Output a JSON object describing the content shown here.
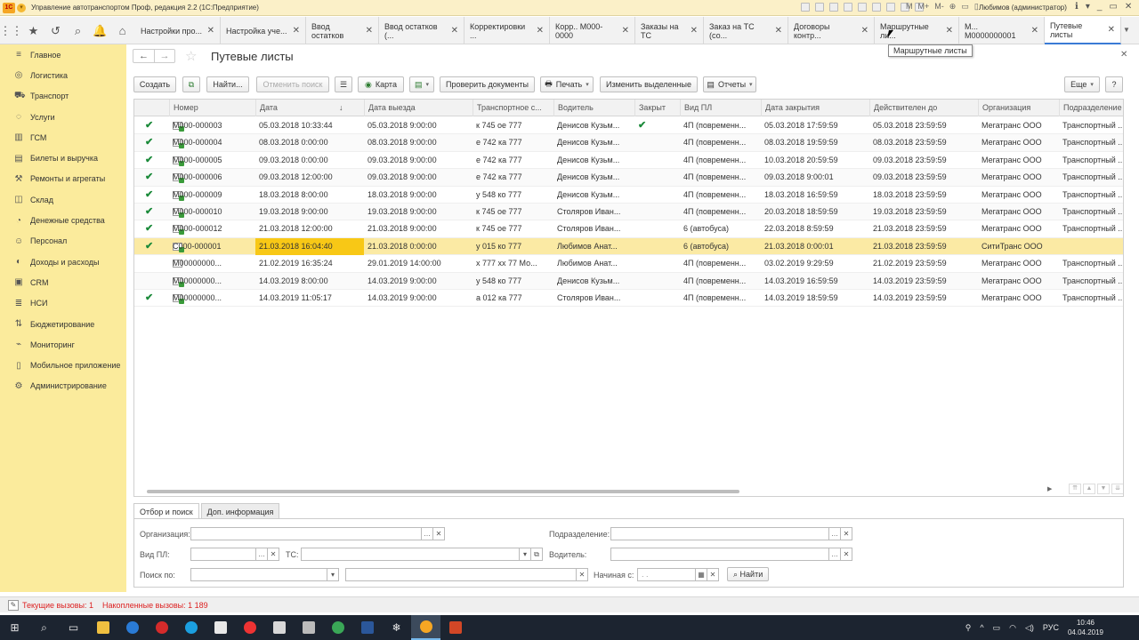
{
  "window": {
    "title": "Управление автотранспортом Проф, редакция 2.2 (1С:Предприятие)",
    "user": "Любимов (администратор)",
    "m_buttons": [
      "M",
      "M+",
      "M-"
    ]
  },
  "tabs": [
    {
      "label": "Настройки про...",
      "active": false
    },
    {
      "label": "Настройка уче...",
      "active": false
    },
    {
      "label": "Ввод остатков",
      "active": false
    },
    {
      "label": "Ввод остатков (...",
      "active": false
    },
    {
      "label": "Корректировки ...",
      "active": false
    },
    {
      "label": "Корр.. М000-0000",
      "active": false
    },
    {
      "label": "Заказы на ТС",
      "active": false
    },
    {
      "label": "Заказ на ТС (со...",
      "active": false
    },
    {
      "label": "Договоры контр...",
      "active": false
    },
    {
      "label": "Маршрутные ли...",
      "active": false
    },
    {
      "label": "М... М0000000001",
      "active": false
    },
    {
      "label": "Путевые листы",
      "active": true
    }
  ],
  "tooltip": "Маршрутные листы",
  "sidebar": {
    "items": [
      {
        "label": "Главное",
        "icon": "menu-icon"
      },
      {
        "label": "Логистика",
        "icon": "compass-icon"
      },
      {
        "label": "Транспорт",
        "icon": "truck-icon"
      },
      {
        "label": "Услуги",
        "icon": "services-icon"
      },
      {
        "label": "ГСМ",
        "icon": "fuel-icon"
      },
      {
        "label": "Билеты и выручка",
        "icon": "ticket-icon"
      },
      {
        "label": "Ремонты и агрегаты",
        "icon": "wrench-icon"
      },
      {
        "label": "Склад",
        "icon": "warehouse-icon"
      },
      {
        "label": "Денежные средства",
        "icon": "money-icon"
      },
      {
        "label": "Персонал",
        "icon": "person-icon"
      },
      {
        "label": "Доходы и расходы",
        "icon": "income-icon"
      },
      {
        "label": "CRM",
        "icon": "crm-icon"
      },
      {
        "label": "НСИ",
        "icon": "reference-icon"
      },
      {
        "label": "Бюджетирование",
        "icon": "budget-icon"
      },
      {
        "label": "Мониторинг",
        "icon": "monitoring-icon"
      },
      {
        "label": "Мобильное приложение",
        "icon": "mobile-icon"
      },
      {
        "label": "Администрирование",
        "icon": "gear-icon"
      }
    ]
  },
  "page": {
    "title": "Путевые листы"
  },
  "commands": {
    "create": "Создать",
    "find": "Найти...",
    "cancel_search": "Отменить поиск",
    "map": "Карта",
    "check_docs": "Проверить документы",
    "print": "Печать",
    "change_selected": "Изменить выделенные",
    "reports": "Отчеты",
    "more": "Еще",
    "help": "?"
  },
  "table": {
    "columns": [
      "Номер",
      "Дата",
      "Дата выезда",
      "Транспортное с...",
      "Водитель",
      "Закрыт",
      "Вид ПЛ",
      "Дата закрытия",
      "Действителен до",
      "Организация",
      "Подразделение"
    ],
    "rows": [
      {
        "posted": true,
        "icon": "posted",
        "cells": [
          "М000-000003",
          "05.03.2018 10:33:44",
          "05.03.2018 9:00:00",
          "к 745 ое 777",
          "Денисов Кузьм...",
          "✔",
          "4П (повременн...",
          "05.03.2018 17:59:59",
          "05.03.2018 23:59:59",
          "Мегатранс ООО",
          "Транспортный ..."
        ]
      },
      {
        "posted": true,
        "icon": "posted",
        "cells": [
          "М000-000004",
          "08.03.2018 0:00:00",
          "08.03.2018 9:00:00",
          "е 742 ка 777",
          "Денисов Кузьм...",
          "",
          "4П (повременн...",
          "08.03.2018 19:59:59",
          "08.03.2018 23:59:59",
          "Мегатранс ООО",
          "Транспортный ..."
        ]
      },
      {
        "posted": true,
        "icon": "posted",
        "cells": [
          "М000-000005",
          "09.03.2018 0:00:00",
          "09.03.2018 9:00:00",
          "е 742 ка 777",
          "Денисов Кузьм...",
          "",
          "4П (повременн...",
          "10.03.2018 20:59:59",
          "09.03.2018 23:59:59",
          "Мегатранс ООО",
          "Транспортный ..."
        ]
      },
      {
        "posted": true,
        "icon": "posted",
        "cells": [
          "М000-000006",
          "09.03.2018 12:00:00",
          "09.03.2018 9:00:00",
          "е 742 ка 777",
          "Денисов Кузьм...",
          "",
          "4П (повременн...",
          "09.03.2018 9:00:01",
          "09.03.2018 23:59:59",
          "Мегатранс ООО",
          "Транспортный ..."
        ]
      },
      {
        "posted": true,
        "icon": "posted",
        "cells": [
          "М000-000009",
          "18.03.2018 8:00:00",
          "18.03.2018 9:00:00",
          "у 548 ко 777",
          "Денисов Кузьм...",
          "",
          "4П (повременн...",
          "18.03.2018 16:59:59",
          "18.03.2018 23:59:59",
          "Мегатранс ООО",
          "Транспортный ..."
        ]
      },
      {
        "posted": true,
        "icon": "posted",
        "cells": [
          "М000-000010",
          "19.03.2018 9:00:00",
          "19.03.2018 9:00:00",
          "к 745 ое 777",
          "Столяров Иван...",
          "",
          "4П (повременн...",
          "20.03.2018 18:59:59",
          "19.03.2018 23:59:59",
          "Мегатранс ООО",
          "Транспортный ..."
        ]
      },
      {
        "posted": true,
        "icon": "posted",
        "cells": [
          "М000-000012",
          "21.03.2018 12:00:00",
          "21.03.2018 9:00:00",
          "к 745 ое 777",
          "Столяров Иван...",
          "",
          "6 (автобуса)",
          "22.03.2018 8:59:59",
          "21.03.2018 23:59:59",
          "Мегатранс ООО",
          "Транспортный ..."
        ]
      },
      {
        "posted": true,
        "icon": "posted",
        "selected": true,
        "cells": [
          "С000-000001",
          "21.03.2018 16:04:40",
          "21.03.2018 0:00:00",
          "у 015 ко 777",
          "Любимов Анат...",
          "",
          "6 (автобуса)",
          "21.03.2018 0:00:01",
          "21.03.2018 23:59:59",
          "СитиТранс ООО",
          ""
        ]
      },
      {
        "posted": false,
        "icon": "plain",
        "cells": [
          "М00000000...",
          "21.02.2019 16:35:24",
          "29.01.2019 14:00:00",
          "х 777 хх 77 Мо...",
          "Любимов Анат...",
          "",
          "4П (повременн...",
          "03.02.2019 9:29:59",
          "21.02.2019 23:59:59",
          "Мегатранс ООО",
          "Транспортный ..."
        ]
      },
      {
        "posted": false,
        "icon": "posted",
        "cells": [
          "М00000000...",
          "14.03.2019 8:00:00",
          "14.03.2019 9:00:00",
          "у 548 ко 777",
          "Денисов Кузьм...",
          "",
          "4П (повременн...",
          "14.03.2019 16:59:59",
          "14.03.2019 23:59:59",
          "Мегатранс ООО",
          "Транспортный ..."
        ]
      },
      {
        "posted": true,
        "icon": "posted",
        "cells": [
          "М00000000...",
          "14.03.2019 11:05:17",
          "14.03.2019 9:00:00",
          "а 012 ка 777",
          "Столяров Иван...",
          "",
          "4П (повременн...",
          "14.03.2019 18:59:59",
          "14.03.2019 23:59:59",
          "Мегатранс ООО",
          "Транспортный ..."
        ]
      }
    ]
  },
  "filter_tabs": [
    "Отбор и поиск",
    "Доп. информация"
  ],
  "filters": {
    "organization_label": "Организация:",
    "department_label": "Подразделение:",
    "pl_type_label": "Вид ПЛ:",
    "vehicle_label": "ТС:",
    "driver_label": "Водитель:",
    "search_by_label": "Поиск по:",
    "starting_with_label": "Начиная с:",
    "date_placeholder": ". .",
    "find_button": "Найти"
  },
  "status_bar": {
    "current_calls": "Текущие вызовы: 1",
    "accumulated_calls": "Накопленные вызовы: 1 189"
  },
  "taskbar": {
    "language": "РУС",
    "time": "10:46",
    "date": "04.04.2019"
  },
  "colors": {
    "sidebar_bg": "#fbeb9c",
    "selected_row": "#fbeaa4",
    "selected_cell": "#f8c816",
    "posted_check": "#1b8a3a",
    "status_text": "#d22222"
  }
}
